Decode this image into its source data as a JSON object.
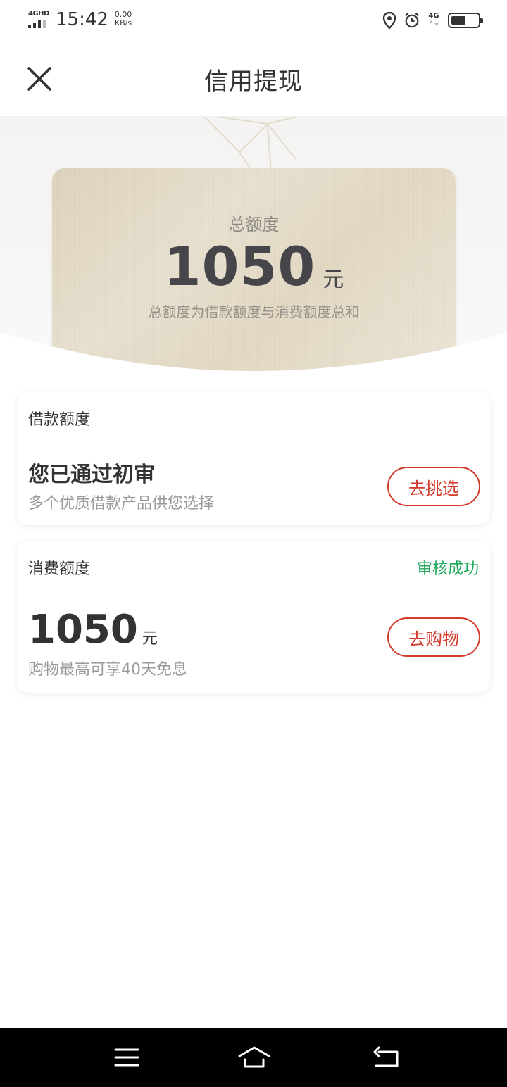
{
  "status_bar": {
    "network": "4GHD",
    "time": "15:42",
    "speed_value": "0.00",
    "speed_unit": "KB/s",
    "network_right": "4G",
    "battery_level": 0.55,
    "icons": [
      "location-icon",
      "alarm-icon",
      "battery-icon"
    ]
  },
  "header": {
    "title": "信用提现",
    "close_icon": "close-icon"
  },
  "hero": {
    "label": "总额度",
    "amount": "1050",
    "unit": "元",
    "description": "总额度为借款额度与消费额度总和"
  },
  "loan_section": {
    "title": "借款额度",
    "headline": "您已通过初审",
    "subtitle": "多个优质借款产品供您选择",
    "button_label": "去挑选"
  },
  "consumption_section": {
    "title": "消费额度",
    "status": "审核成功",
    "amount": "1050",
    "unit": "元",
    "subtitle": "购物最高可享40天免息",
    "button_label": "去购物"
  },
  "nav_bar": {
    "icons": [
      "menu-icon",
      "home-icon",
      "back-icon"
    ]
  },
  "colors": {
    "accent_red": "#d23a2a",
    "status_green": "#1ea85b",
    "gold_card": "#e4dac6",
    "nav_bar": "#000000"
  }
}
